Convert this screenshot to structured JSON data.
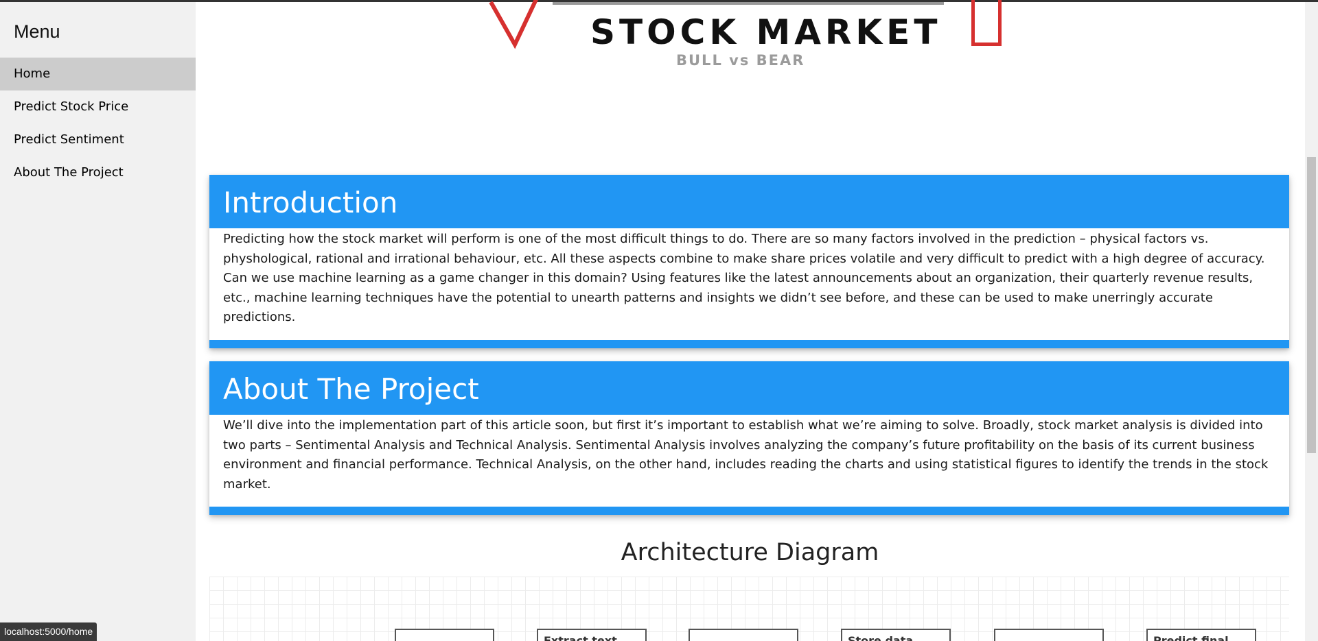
{
  "sidebar": {
    "title": "Menu",
    "items": [
      {
        "label": "Home",
        "active": true
      },
      {
        "label": "Predict Stock Price",
        "active": false
      },
      {
        "label": "Predict Sentiment",
        "active": false
      },
      {
        "label": "About The Project",
        "active": false
      }
    ]
  },
  "logo": {
    "title": "STOCK MARKET",
    "subtitle": "BULL vs BEAR",
    "accent": "#d6302f"
  },
  "cards": [
    {
      "heading": "Introduction",
      "body": "Predicting how the stock market will perform is one of the most difficult things to do. There are so many factors involved in the prediction – physical factors vs. physhological, rational and irrational behaviour, etc. All these aspects combine to make share prices volatile and very difficult to predict with a high degree of accuracy. Can we use machine learning as a game changer in this domain? Using features like the latest announcements about an organization, their quarterly revenue results, etc., machine learning techniques have the potential to unearth patterns and insights we didn’t see before, and these can be used to make unerringly accurate predictions."
    },
    {
      "heading": "About The Project",
      "body": "We’ll dive into the implementation part of this article soon, but first it’s important to establish what we’re aiming to solve. Broadly, stock market analysis is divided into two parts – Sentimental Analysis and Technical Analysis. Sentimental Analysis involves analyzing the company’s future profitability on the basis of its current business environment and financial performance. Technical Analysis, on the other hand, includes reading the charts and using statistical figures to identify the trends in the stock market."
    }
  ],
  "architecture": {
    "title": "Architecture Diagram",
    "boxes": [
      "",
      "Extract text",
      "",
      "Store data",
      "",
      "Predict final"
    ]
  },
  "status_bar": {
    "url": "localhost:5000/home"
  },
  "colors": {
    "accent": "#2196f3",
    "sidebar_bg": "#f1f1f1",
    "active_item_bg": "#cccccc"
  }
}
